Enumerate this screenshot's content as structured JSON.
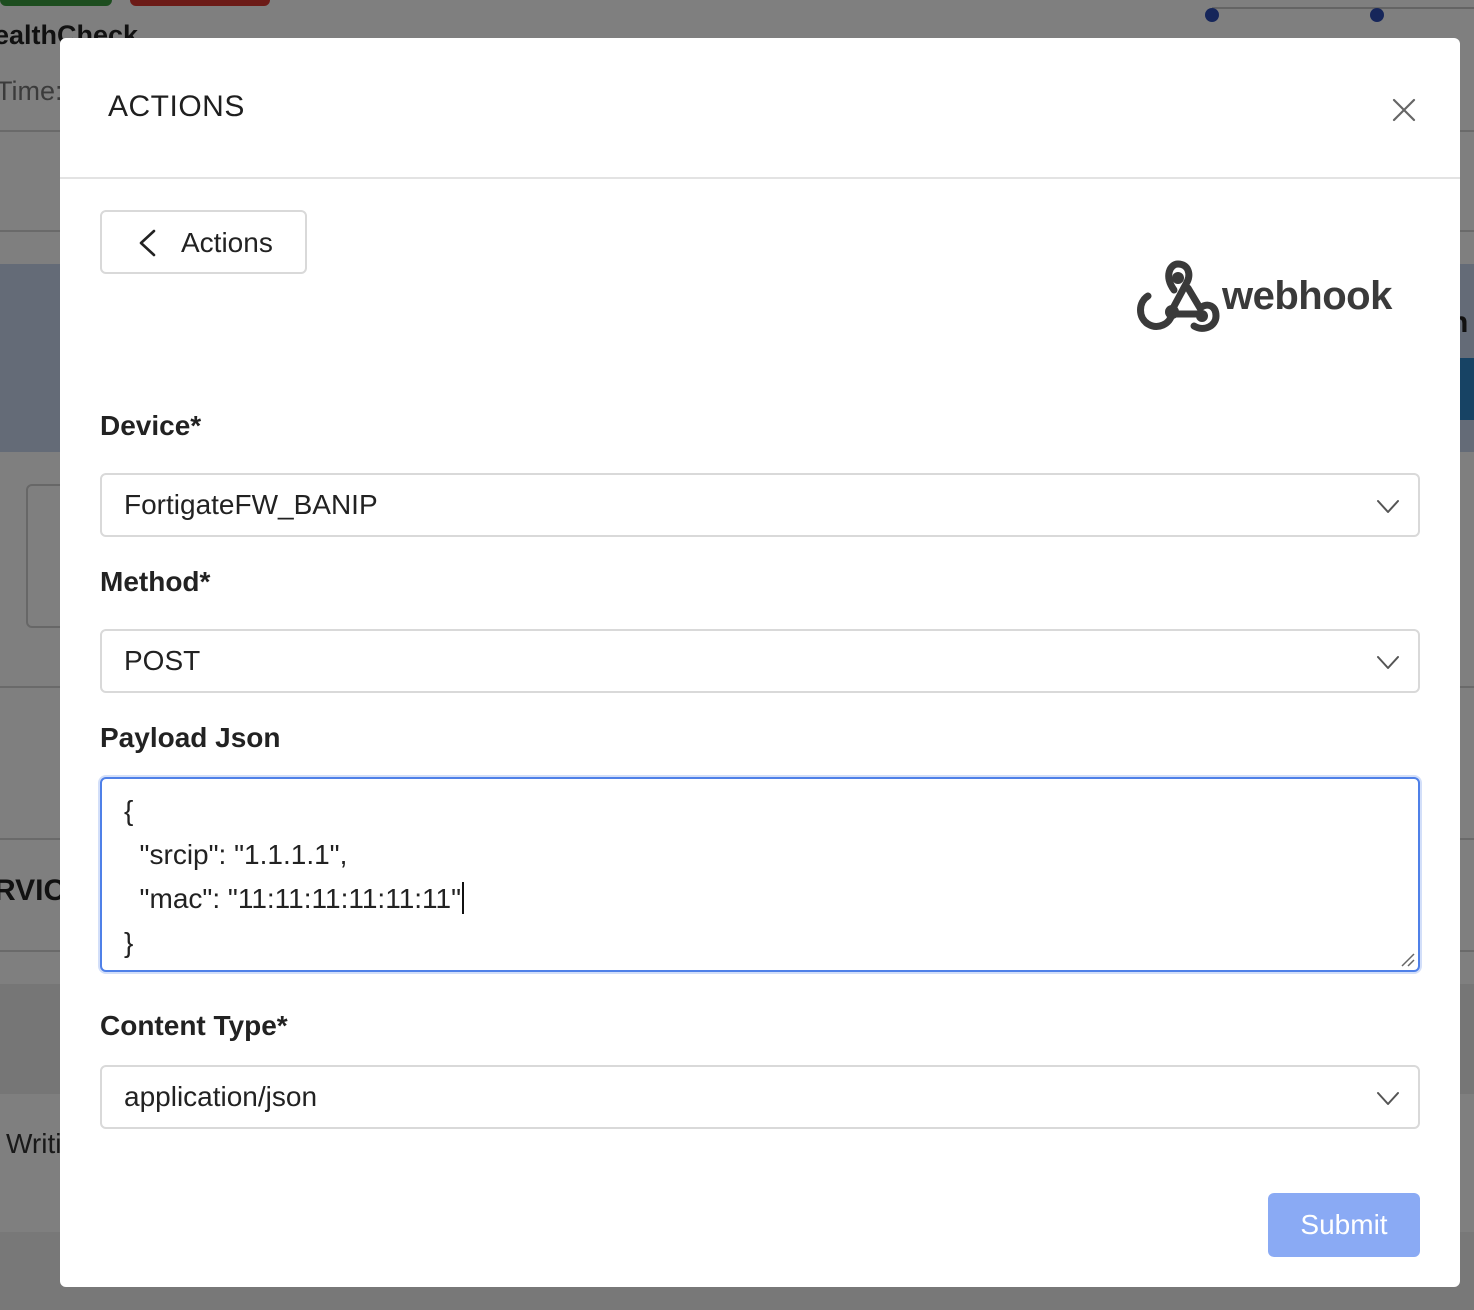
{
  "background": {
    "page_title_fragment": "ealthCheck",
    "time_label_fragment": "Time:",
    "section_fragment": "RVICI",
    "right_fragment": "n",
    "bottom_fragment": "Writi"
  },
  "modal": {
    "title": "ACTIONS",
    "close_icon": "close-icon",
    "back_button": {
      "label": "Actions",
      "icon": "chevron-left-icon"
    },
    "logo": {
      "text": "webhook",
      "icon": "webhook-icon"
    },
    "fields": {
      "device": {
        "label": "Device*",
        "value": "FortigateFW_BANIP"
      },
      "method": {
        "label": "Method*",
        "value": "POST"
      },
      "payload": {
        "label": "Payload Json",
        "lines": [
          "{",
          "  \"srcip\": \"1.1.1.1\",",
          "  \"mac\": \"11:11:11:11:11:11\"",
          "}"
        ]
      },
      "content_type": {
        "label": "Content Type*",
        "value": "application/json"
      }
    },
    "submit_label": "Submit"
  },
  "colors": {
    "accent_focus": "#4f80e8",
    "submit_bg": "#8aaaf4",
    "overlay": "rgba(0,0,0,0.5)"
  }
}
